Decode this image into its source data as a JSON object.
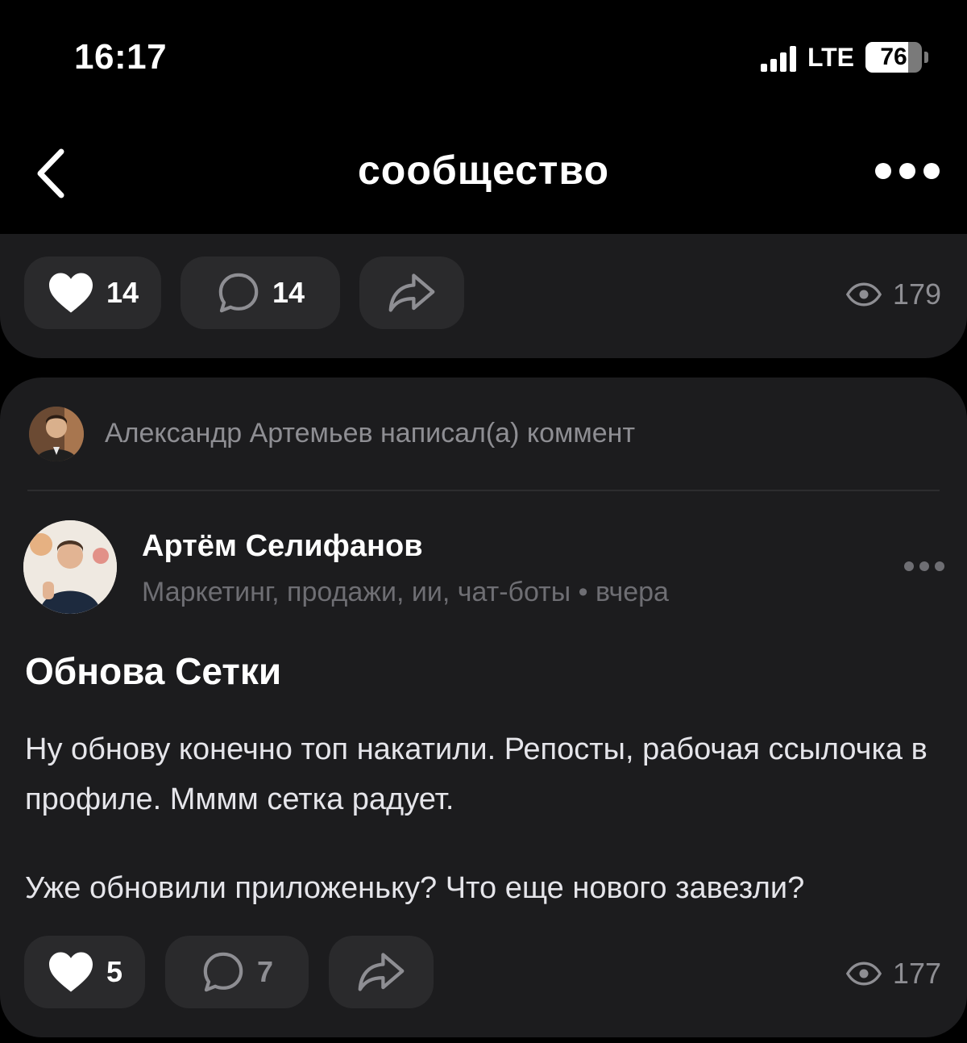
{
  "status": {
    "time": "16:17",
    "network": "LTE",
    "battery": "76"
  },
  "header": {
    "title": "сообщество"
  },
  "prev_post": {
    "likes": "14",
    "comments": "14",
    "views": "179"
  },
  "notification": {
    "text": "Александр Артемьев написал(а) коммент"
  },
  "post": {
    "author": "Артём Селифанов",
    "meta": "Маркетинг, продажи, ии, чат-боты • вчера",
    "title": "Обнова Сетки",
    "paragraph1": "Ну обнову конечно топ накатили. Репосты, рабочая ссылочка в профиле. Мммм сетка радует.",
    "paragraph2": "Уже обновили приложеньку? Что еще нового завезли?",
    "likes": "5",
    "comments": "7",
    "views": "177"
  },
  "icons": {
    "back": "chevron-left-icon",
    "more": "more-horizontal-icon",
    "like": "heart-icon",
    "comment": "comment-bubble-icon",
    "share": "share-arrow-icon",
    "views": "eye-icon"
  }
}
